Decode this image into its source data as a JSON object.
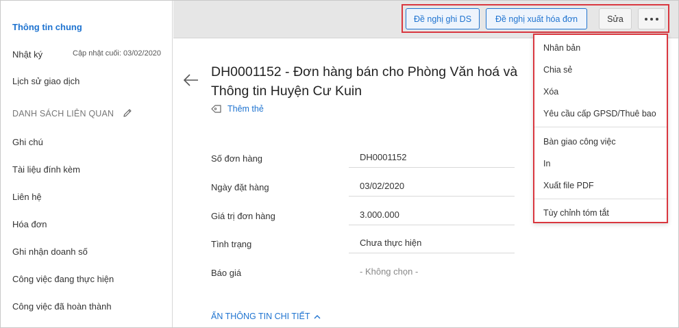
{
  "sidebar": {
    "general_info": "Thông tin chung",
    "journal": "Nhật ký",
    "last_updated": "Cập nhật cuối: 03/02/2020",
    "transaction_history": "Lịch sử giao dịch",
    "related_section": "DANH SÁCH LIÊN QUAN",
    "items": [
      {
        "label": "Ghi chú"
      },
      {
        "label": "Tài liệu đính kèm"
      },
      {
        "label": "Liên hệ"
      },
      {
        "label": "Hóa đơn"
      },
      {
        "label": "Ghi nhận doanh số"
      },
      {
        "label": "Công việc đang thực hiện"
      },
      {
        "label": "Công việc đã hoàn thành"
      }
    ]
  },
  "toolbar": {
    "propose_record": "Đề nghị ghi DS",
    "propose_invoice": "Đề nghị xuất hóa đơn",
    "edit": "Sửa",
    "more_icon": "more-dots-icon"
  },
  "main": {
    "title": "DH0001152 - Đơn hàng bán cho Phòng Văn hoá và Thông tin Huyện Cư Kuin",
    "add_tag": "Thêm thẻ",
    "fields": [
      {
        "label": "Số đơn hàng",
        "value": "DH0001152"
      },
      {
        "label": "Ngày đặt hàng",
        "value": "03/02/2020"
      },
      {
        "label": "Giá trị đơn hàng",
        "value": "3.000.000"
      },
      {
        "label": "Tình trạng",
        "value": "Chưa thực hiện"
      },
      {
        "label": "Báo giá",
        "value": "- Không chọn -"
      }
    ],
    "hide_details": "ẨN THÔNG TIN CHI TIẾT"
  },
  "menu": {
    "items": [
      {
        "label": "Nhân bản"
      },
      {
        "label": "Chia sẻ"
      },
      {
        "label": "Xóa"
      },
      {
        "label": "Yêu cầu cấp GPSD/Thuê bao"
      },
      {
        "label": "Bàn giao công việc"
      },
      {
        "label": "In"
      },
      {
        "label": "Xuất file PDF"
      },
      {
        "label": "Tùy chỉnh tóm tắt"
      }
    ]
  },
  "colors": {
    "accent": "#1e73d0",
    "highlight": "#d9363e",
    "topbar": "#e6e6e6"
  }
}
